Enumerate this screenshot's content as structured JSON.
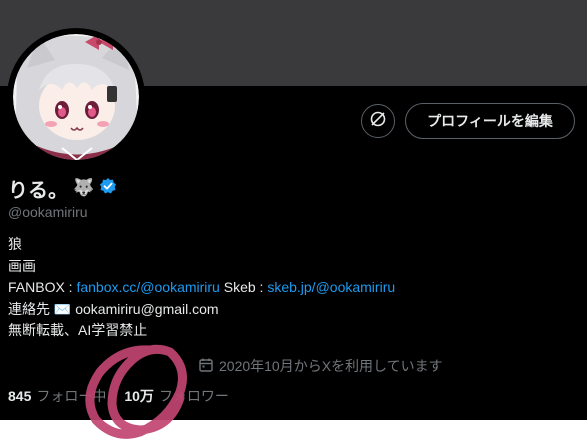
{
  "profile": {
    "display_name": "りる。",
    "wolf_emoji": "🐺",
    "handle": "@ookamiriru",
    "edit_profile_label": "プロフィールを編集",
    "bio": {
      "line1": "狼",
      "line2": "画画",
      "fanbox_prefix": "FANBOX : ",
      "fanbox_link": "fanbox.cc/@ookamiriru",
      "skeb_prefix": " Skeb : ",
      "skeb_link": "skeb.jp/@ookamiriru",
      "contact_prefix": "連絡先 ",
      "contact_emoji": "✉️",
      "contact_email": " ookamiriru@gmail.com",
      "line5": "無断転載、AI学習禁止"
    },
    "joined": "2020年10月からXを利用しています",
    "following": {
      "count": "845",
      "label": "フォロー中"
    },
    "followers": {
      "count": "10万",
      "label": "フォロワー"
    }
  },
  "icons": {
    "verified": "verified-badge-icon",
    "calendar": "calendar-icon",
    "premium": "premium-circle-icon"
  },
  "colors": {
    "background": "#000000",
    "banner": "#3a3a3d",
    "link": "#1d9bf0",
    "verified": "#1d9bf0",
    "scribble": "#c04470"
  }
}
